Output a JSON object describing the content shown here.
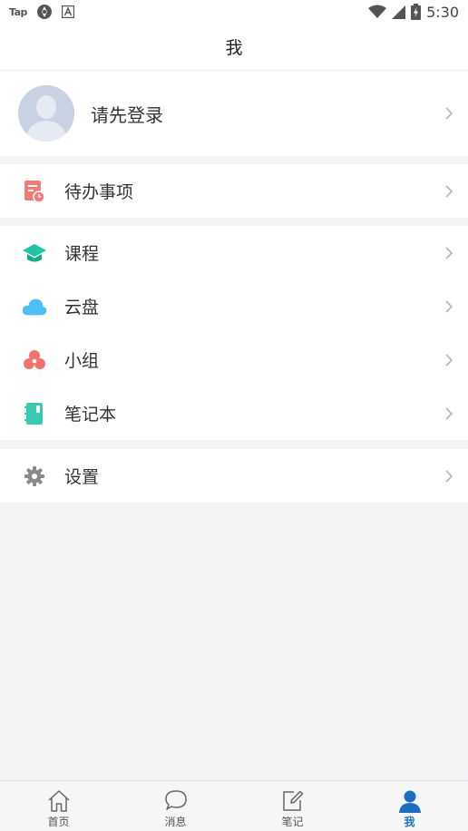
{
  "status_bar": {
    "carrier_label": "Tap",
    "time": "5:30"
  },
  "header": {
    "title": "我"
  },
  "profile": {
    "login_prompt": "请先登录"
  },
  "menu": {
    "todo": {
      "label": "待办事项",
      "icon": "todo-icon",
      "color": "#f47a76"
    },
    "courses": {
      "label": "课程",
      "icon": "graduation-cap-icon",
      "color": "#1fc4a3"
    },
    "cloud": {
      "label": "云盘",
      "icon": "cloud-icon",
      "color": "#4fbdf6"
    },
    "groups": {
      "label": "小组",
      "icon": "group-icon",
      "color": "#f2736e"
    },
    "notebook": {
      "label": "笔记本",
      "icon": "notebook-icon",
      "color": "#36cbb0"
    },
    "settings": {
      "label": "设置",
      "icon": "gear-icon",
      "color": "#8a8a8a"
    }
  },
  "tabbar": {
    "tabs": [
      {
        "label": "首页",
        "icon": "home-icon"
      },
      {
        "label": "消息",
        "icon": "message-icon"
      },
      {
        "label": "笔记",
        "icon": "note-edit-icon"
      },
      {
        "label": "我",
        "icon": "profile-icon"
      }
    ],
    "active_index": 3,
    "active_color": "#1b6fc1"
  }
}
